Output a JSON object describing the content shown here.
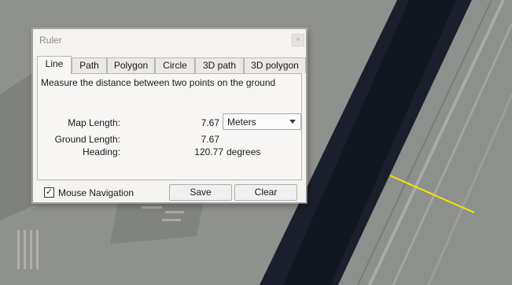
{
  "window": {
    "title": "Ruler",
    "close_glyph": "×"
  },
  "tabs": [
    {
      "label": "Line",
      "active": true
    },
    {
      "label": "Path",
      "active": false
    },
    {
      "label": "Polygon",
      "active": false
    },
    {
      "label": "Circle",
      "active": false
    },
    {
      "label": "3D path",
      "active": false
    },
    {
      "label": "3D polygon",
      "active": false
    }
  ],
  "panel": {
    "description": "Measure the distance between two points on the ground",
    "map_length": {
      "label": "Map Length:",
      "value": "7.67"
    },
    "ground_length": {
      "label": "Ground Length:",
      "value": "7.67"
    },
    "heading": {
      "label": "Heading:",
      "value": "120.77",
      "unit": "degrees"
    },
    "unit_select": {
      "selected": "Meters"
    }
  },
  "footer": {
    "mouse_navigation": {
      "label": "Mouse Navigation",
      "checked": true,
      "check_glyph": "✓"
    },
    "save_label": "Save",
    "clear_label": "Clear"
  },
  "measure_line": {
    "color": "#f2e600"
  }
}
